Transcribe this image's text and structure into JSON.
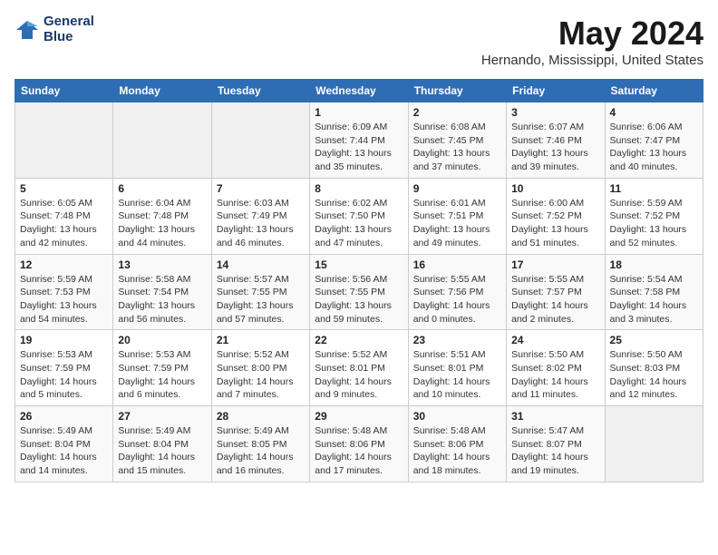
{
  "logo": {
    "line1": "General",
    "line2": "Blue"
  },
  "title": "May 2024",
  "subtitle": "Hernando, Mississippi, United States",
  "weekdays": [
    "Sunday",
    "Monday",
    "Tuesday",
    "Wednesday",
    "Thursday",
    "Friday",
    "Saturday"
  ],
  "weeks": [
    [
      {
        "day": "",
        "info": ""
      },
      {
        "day": "",
        "info": ""
      },
      {
        "day": "",
        "info": ""
      },
      {
        "day": "1",
        "info": "Sunrise: 6:09 AM\nSunset: 7:44 PM\nDaylight: 13 hours\nand 35 minutes."
      },
      {
        "day": "2",
        "info": "Sunrise: 6:08 AM\nSunset: 7:45 PM\nDaylight: 13 hours\nand 37 minutes."
      },
      {
        "day": "3",
        "info": "Sunrise: 6:07 AM\nSunset: 7:46 PM\nDaylight: 13 hours\nand 39 minutes."
      },
      {
        "day": "4",
        "info": "Sunrise: 6:06 AM\nSunset: 7:47 PM\nDaylight: 13 hours\nand 40 minutes."
      }
    ],
    [
      {
        "day": "5",
        "info": "Sunrise: 6:05 AM\nSunset: 7:48 PM\nDaylight: 13 hours\nand 42 minutes."
      },
      {
        "day": "6",
        "info": "Sunrise: 6:04 AM\nSunset: 7:48 PM\nDaylight: 13 hours\nand 44 minutes."
      },
      {
        "day": "7",
        "info": "Sunrise: 6:03 AM\nSunset: 7:49 PM\nDaylight: 13 hours\nand 46 minutes."
      },
      {
        "day": "8",
        "info": "Sunrise: 6:02 AM\nSunset: 7:50 PM\nDaylight: 13 hours\nand 47 minutes."
      },
      {
        "day": "9",
        "info": "Sunrise: 6:01 AM\nSunset: 7:51 PM\nDaylight: 13 hours\nand 49 minutes."
      },
      {
        "day": "10",
        "info": "Sunrise: 6:00 AM\nSunset: 7:52 PM\nDaylight: 13 hours\nand 51 minutes."
      },
      {
        "day": "11",
        "info": "Sunrise: 5:59 AM\nSunset: 7:52 PM\nDaylight: 13 hours\nand 52 minutes."
      }
    ],
    [
      {
        "day": "12",
        "info": "Sunrise: 5:59 AM\nSunset: 7:53 PM\nDaylight: 13 hours\nand 54 minutes."
      },
      {
        "day": "13",
        "info": "Sunrise: 5:58 AM\nSunset: 7:54 PM\nDaylight: 13 hours\nand 56 minutes."
      },
      {
        "day": "14",
        "info": "Sunrise: 5:57 AM\nSunset: 7:55 PM\nDaylight: 13 hours\nand 57 minutes."
      },
      {
        "day": "15",
        "info": "Sunrise: 5:56 AM\nSunset: 7:55 PM\nDaylight: 13 hours\nand 59 minutes."
      },
      {
        "day": "16",
        "info": "Sunrise: 5:55 AM\nSunset: 7:56 PM\nDaylight: 14 hours\nand 0 minutes."
      },
      {
        "day": "17",
        "info": "Sunrise: 5:55 AM\nSunset: 7:57 PM\nDaylight: 14 hours\nand 2 minutes."
      },
      {
        "day": "18",
        "info": "Sunrise: 5:54 AM\nSunset: 7:58 PM\nDaylight: 14 hours\nand 3 minutes."
      }
    ],
    [
      {
        "day": "19",
        "info": "Sunrise: 5:53 AM\nSunset: 7:59 PM\nDaylight: 14 hours\nand 5 minutes."
      },
      {
        "day": "20",
        "info": "Sunrise: 5:53 AM\nSunset: 7:59 PM\nDaylight: 14 hours\nand 6 minutes."
      },
      {
        "day": "21",
        "info": "Sunrise: 5:52 AM\nSunset: 8:00 PM\nDaylight: 14 hours\nand 7 minutes."
      },
      {
        "day": "22",
        "info": "Sunrise: 5:52 AM\nSunset: 8:01 PM\nDaylight: 14 hours\nand 9 minutes."
      },
      {
        "day": "23",
        "info": "Sunrise: 5:51 AM\nSunset: 8:01 PM\nDaylight: 14 hours\nand 10 minutes."
      },
      {
        "day": "24",
        "info": "Sunrise: 5:50 AM\nSunset: 8:02 PM\nDaylight: 14 hours\nand 11 minutes."
      },
      {
        "day": "25",
        "info": "Sunrise: 5:50 AM\nSunset: 8:03 PM\nDaylight: 14 hours\nand 12 minutes."
      }
    ],
    [
      {
        "day": "26",
        "info": "Sunrise: 5:49 AM\nSunset: 8:04 PM\nDaylight: 14 hours\nand 14 minutes."
      },
      {
        "day": "27",
        "info": "Sunrise: 5:49 AM\nSunset: 8:04 PM\nDaylight: 14 hours\nand 15 minutes."
      },
      {
        "day": "28",
        "info": "Sunrise: 5:49 AM\nSunset: 8:05 PM\nDaylight: 14 hours\nand 16 minutes."
      },
      {
        "day": "29",
        "info": "Sunrise: 5:48 AM\nSunset: 8:06 PM\nDaylight: 14 hours\nand 17 minutes."
      },
      {
        "day": "30",
        "info": "Sunrise: 5:48 AM\nSunset: 8:06 PM\nDaylight: 14 hours\nand 18 minutes."
      },
      {
        "day": "31",
        "info": "Sunrise: 5:47 AM\nSunset: 8:07 PM\nDaylight: 14 hours\nand 19 minutes."
      },
      {
        "day": "",
        "info": ""
      }
    ]
  ]
}
